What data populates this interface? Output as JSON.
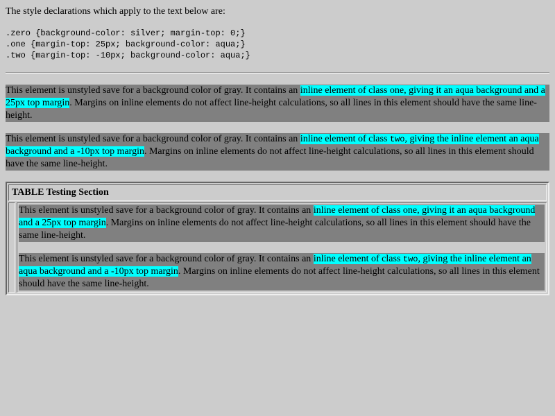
{
  "intro": "The style declarations which apply to the text below are:",
  "css_rules": [
    ".zero {background-color: silver; margin-top: 0;}",
    ".one {margin-top: 25px; background-color: aqua;}",
    ".two {margin-top: -10px; background-color: aqua;}"
  ],
  "para_one": {
    "before": "This element is unstyled save for a background color of gray. It contains an ",
    "highlight_pre": "inline element of class ",
    "highlight_class": "one",
    "highlight_post": ", giving it an aqua background and a 25px top margin",
    "after": ". Margins on inline elements do not affect line-height calculations, so all lines in this element should have the same line-height."
  },
  "para_two": {
    "before": "This element is unstyled save for a background color of gray. It contains an ",
    "highlight_pre": "inline element of class ",
    "highlight_class": "two",
    "highlight_post": ", giving the inline element an aqua background and a -10px top margin",
    "after": ". Margins on inline elements do not affect line-height calculations, so all lines in this element should have the same line-height."
  },
  "table": {
    "title": "TABLE Testing Section"
  },
  "colors": {
    "page_bg": "#cccccc",
    "gray": "#808080",
    "aqua": "#00ffff"
  }
}
